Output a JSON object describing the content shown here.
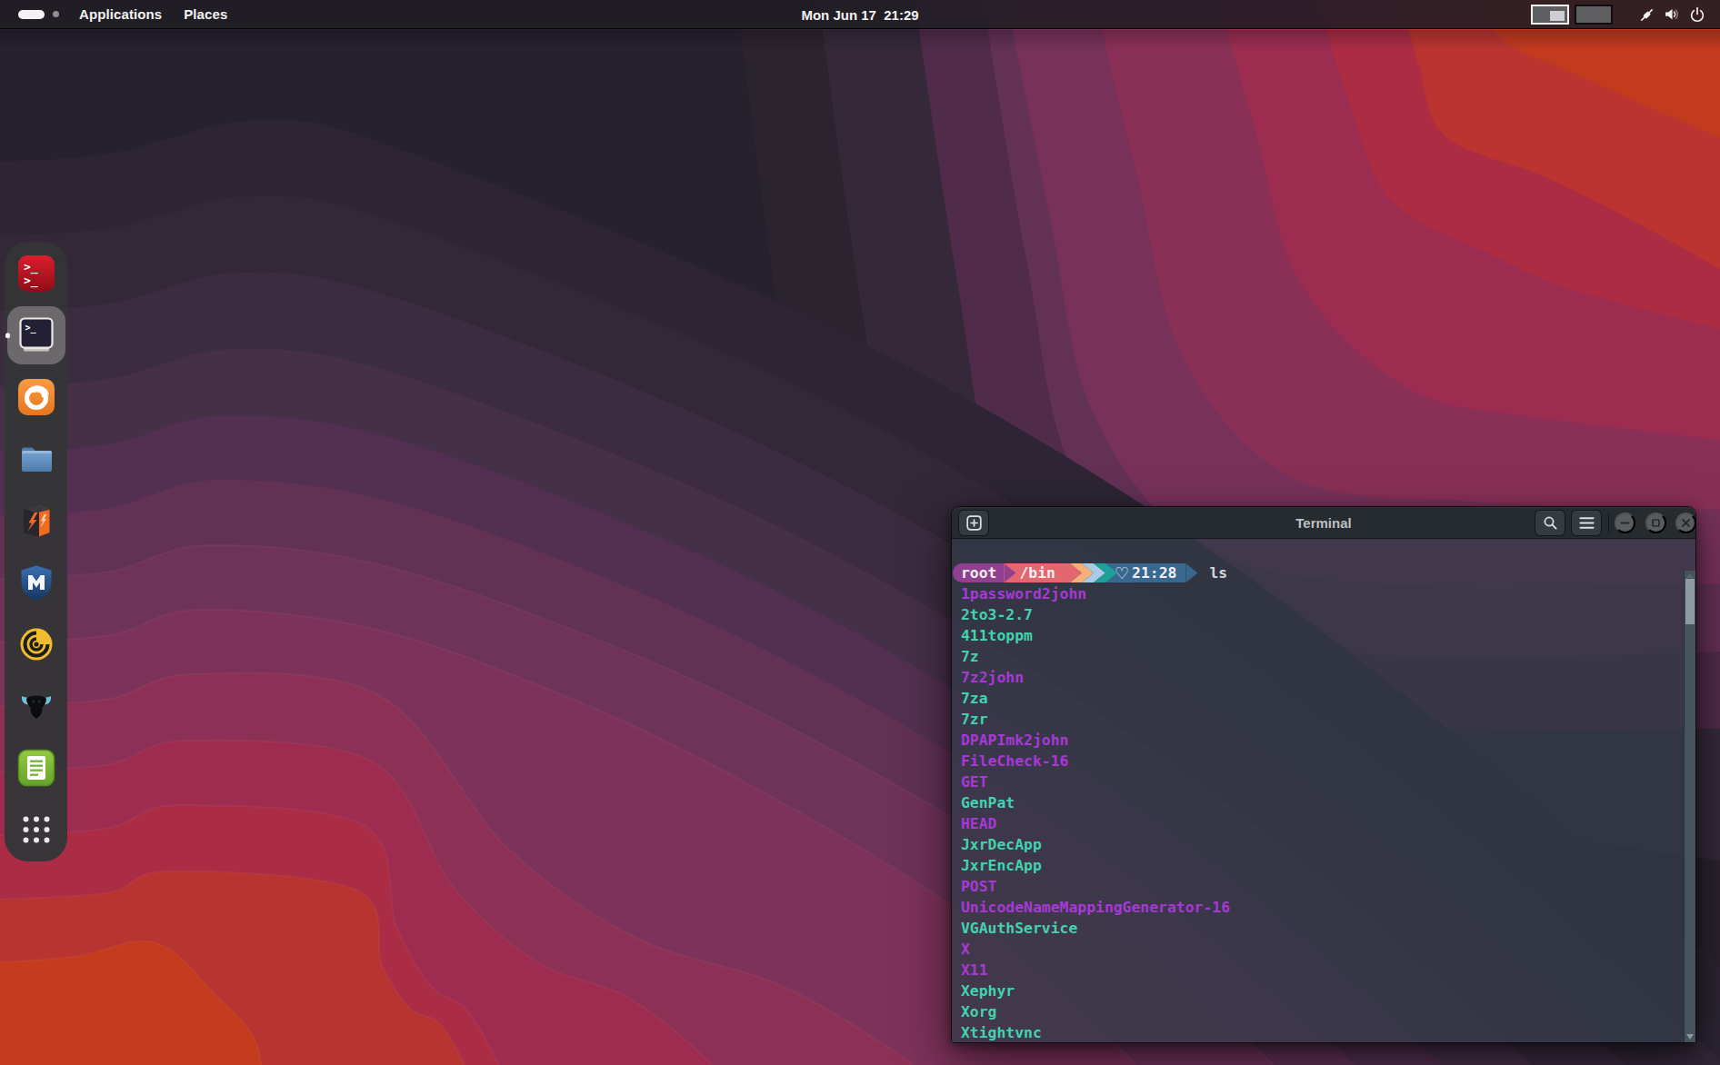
{
  "panel": {
    "menus": [
      {
        "label": "Applications"
      },
      {
        "label": "Places"
      }
    ],
    "clock": "Mon Jun 17  21:29",
    "workspaces": {
      "count": 2,
      "active": 1
    },
    "status_icons": [
      "network",
      "volume",
      "power"
    ]
  },
  "dock": {
    "items": [
      {
        "id": "kali-root-terminal",
        "label": "Root Terminal Emulator"
      },
      {
        "id": "gnome-terminal",
        "label": "Terminal",
        "focused": true,
        "running": true
      },
      {
        "id": "firefox",
        "label": "Firefox ESR"
      },
      {
        "id": "files",
        "label": "Files"
      },
      {
        "id": "burpsuite",
        "label": "Burp Suite"
      },
      {
        "id": "metasploit",
        "label": "Metasploit Framework"
      },
      {
        "id": "faraday",
        "label": "Faraday IDE"
      },
      {
        "id": "beef",
        "label": "BeEF"
      },
      {
        "id": "cherrytree",
        "label": "CherryTree"
      },
      {
        "id": "app-grid",
        "label": "Show Applications"
      }
    ]
  },
  "window": {
    "title": "Terminal",
    "controls": {
      "new_tab": "New Tab",
      "search": "Search",
      "menu": "Menu",
      "minimize": "Minimize",
      "maximize": "Maximize",
      "close": "Close"
    }
  },
  "terminal": {
    "prompt": {
      "user": "root",
      "path": "/bin",
      "heart": "♡",
      "time": "21:28"
    },
    "command": "ls",
    "listing": [
      {
        "name": "1password2john",
        "type": "symlink"
      },
      {
        "name": "2to3-2.7",
        "type": "executable"
      },
      {
        "name": "411toppm",
        "type": "executable"
      },
      {
        "name": "7z",
        "type": "executable"
      },
      {
        "name": "7z2john",
        "type": "symlink"
      },
      {
        "name": "7za",
        "type": "executable"
      },
      {
        "name": "7zr",
        "type": "executable"
      },
      {
        "name": "DPAPImk2john",
        "type": "symlink"
      },
      {
        "name": "FileCheck-16",
        "type": "symlink"
      },
      {
        "name": "GET",
        "type": "symlink"
      },
      {
        "name": "GenPat",
        "type": "executable"
      },
      {
        "name": "HEAD",
        "type": "symlink"
      },
      {
        "name": "JxrDecApp",
        "type": "executable"
      },
      {
        "name": "JxrEncApp",
        "type": "executable"
      },
      {
        "name": "POST",
        "type": "symlink"
      },
      {
        "name": "UnicodeNameMappingGenerator-16",
        "type": "symlink"
      },
      {
        "name": "VGAuthService",
        "type": "executable"
      },
      {
        "name": "X",
        "type": "symlink"
      },
      {
        "name": "X11",
        "type": "symlink"
      },
      {
        "name": "Xephyr",
        "type": "executable"
      },
      {
        "name": "Xorg",
        "type": "executable"
      },
      {
        "name": "Xtightvnc",
        "type": "executable"
      }
    ],
    "colors": {
      "executable": "#43d2ae",
      "symlink": "#a838d8",
      "prompt-user-bg": "#91408f",
      "prompt-path-bg": "#e4666f",
      "prompt-time-bg": "#39688e",
      "chevron-orange": "#f5b07a",
      "chevron-blue": "#a8cce8",
      "chevron-teal": "#1ea098"
    }
  }
}
